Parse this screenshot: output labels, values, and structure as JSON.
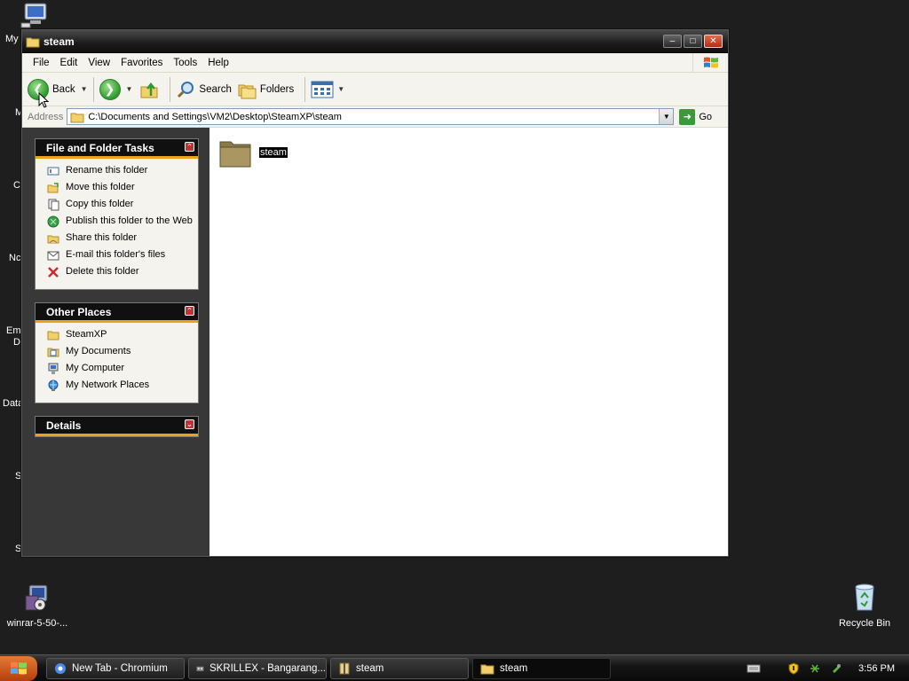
{
  "desktop": {
    "fragments": [
      "My",
      "M",
      "C",
      "Nc",
      "Em",
      "D",
      "Data",
      "S",
      "S"
    ],
    "icons": [
      {
        "label": "winrar-5-50-..."
      },
      {
        "label": "Recycle Bin"
      }
    ]
  },
  "window": {
    "title": "steam",
    "menu": [
      "File",
      "Edit",
      "View",
      "Favorites",
      "Tools",
      "Help"
    ],
    "toolbar": {
      "back": "Back",
      "search": "Search",
      "folders": "Folders"
    },
    "address": {
      "label": "Address",
      "value": "C:\\Documents and Settings\\VM2\\Desktop\\SteamXP\\steam",
      "go": "Go"
    },
    "panels": {
      "file_tasks": {
        "title": "File and Folder Tasks",
        "items": [
          {
            "label": "Rename this folder",
            "icon": "rename-icon"
          },
          {
            "label": "Move this folder",
            "icon": "move-icon"
          },
          {
            "label": "Copy this folder",
            "icon": "copy-icon"
          },
          {
            "label": "Publish this folder to the Web",
            "icon": "globe-icon"
          },
          {
            "label": "Share this folder",
            "icon": "share-icon"
          },
          {
            "label": "E-mail this folder's files",
            "icon": "email-icon"
          },
          {
            "label": "Delete this folder",
            "icon": "delete-icon"
          }
        ]
      },
      "other_places": {
        "title": "Other Places",
        "items": [
          {
            "label": "SteamXP",
            "icon": "folder-icon"
          },
          {
            "label": "My Documents",
            "icon": "documents-icon"
          },
          {
            "label": "My Computer",
            "icon": "computer-icon"
          },
          {
            "label": "My Network Places",
            "icon": "network-icon"
          }
        ]
      },
      "details": {
        "title": "Details"
      }
    },
    "files": [
      {
        "name": "steam",
        "icon": "folder-icon",
        "selected": true
      }
    ]
  },
  "taskbar": {
    "buttons": [
      {
        "label": "New Tab - Chromium",
        "icon": "chromium-icon"
      },
      {
        "label": "SKRILLEX - Bangarang...",
        "icon": "media-icon"
      },
      {
        "label": "steam",
        "icon": "archive-icon"
      },
      {
        "label": "steam",
        "icon": "folder-icon",
        "active": true
      }
    ],
    "clock": "3:56 PM"
  },
  "colors": {
    "panel_accent": "#e8a317",
    "desktop_bg": "#1e1e1e",
    "selection": "#000000"
  }
}
